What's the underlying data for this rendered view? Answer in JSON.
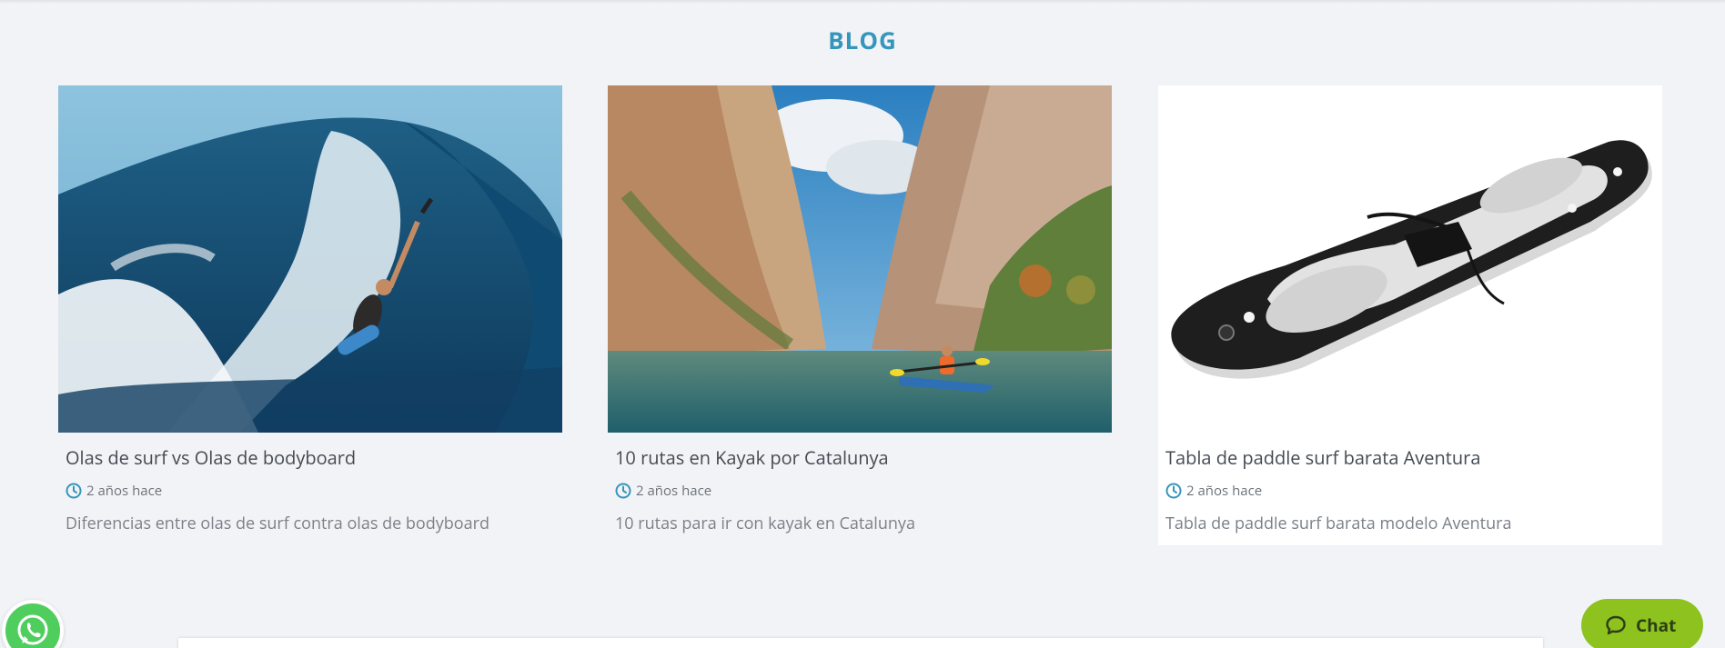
{
  "section": {
    "title": "BLOG"
  },
  "posts": [
    {
      "title": "Olas de surf vs Olas de bodyboard",
      "date": "2 años hace",
      "excerpt": "Diferencias entre olas de surf contra olas de bodyboard",
      "image": "bodyboarder-wave-photo"
    },
    {
      "title": "10 rutas en Kayak por Catalunya",
      "date": "2 años hace",
      "excerpt": "10 rutas para ir con kayak en Catalunya",
      "image": "kayak-canyon-photo"
    },
    {
      "title": "Tabla de paddle surf barata Aventura",
      "date": "2 años hace",
      "excerpt": "Tabla de paddle surf barata modelo Aventura",
      "image": "paddle-board-product-photo"
    }
  ],
  "widgets": {
    "whatsapp_icon": "whatsapp-icon",
    "chat_label": "Chat",
    "chat_icon": "chat-bubble-icon"
  },
  "colors": {
    "accent": "#3596bd",
    "background": "#f2f3f6",
    "chat_button": "#8dc21f",
    "whatsapp": "#4fce5d"
  }
}
